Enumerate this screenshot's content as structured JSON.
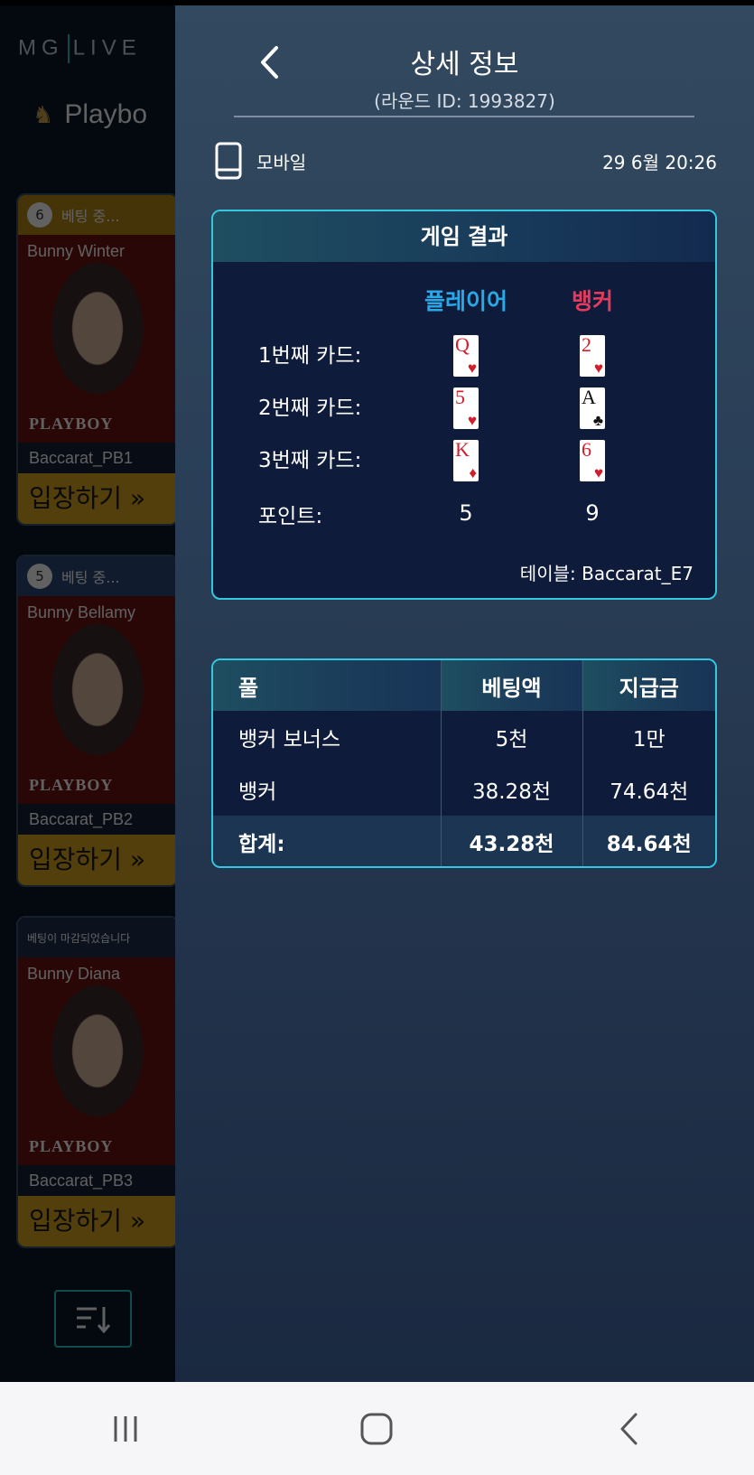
{
  "lobby": {
    "logo_left": "MG",
    "logo_right": "LIVE",
    "brand": "Playbo",
    "cards": [
      {
        "status_num": "6",
        "status": "베팅 중...",
        "dealer": "Bunny Winter",
        "watermark": "PLAYBOY",
        "table": "Baccarat_PB1",
        "enter": "입장하기 »"
      },
      {
        "status_num": "5",
        "status": "베팅 중...",
        "dealer": "Bunny Bellamy",
        "watermark": "PLAYBOY",
        "table": "Baccarat_PB2",
        "enter": "입장하기 »"
      },
      {
        "status_num": "",
        "status": "베팅이 마감되었습니다",
        "dealer": "Bunny Diana",
        "watermark": "PLAYBOY",
        "table": "Baccarat_PB3",
        "enter": "입장하기 »"
      }
    ]
  },
  "panel": {
    "title": "상세 정보",
    "subtitle": "(라운드 ID: 1993827)",
    "device": "모바일",
    "datetime": "29  6월 20:26"
  },
  "result": {
    "header": "게임 결과",
    "player_label": "플레이어",
    "banker_label": "뱅커",
    "rows": [
      {
        "label": "1번째  카드:",
        "player": {
          "rank": "Q",
          "suit": "♥",
          "color": "red"
        },
        "banker": {
          "rank": "2",
          "suit": "♥",
          "color": "red"
        }
      },
      {
        "label": "2번째 카드:",
        "player": {
          "rank": "5",
          "suit": "♥",
          "color": "red"
        },
        "banker": {
          "rank": "A",
          "suit": "♣",
          "color": "black"
        }
      },
      {
        "label": "3번째 카드:",
        "player": {
          "rank": "K",
          "suit": "♦",
          "color": "red"
        },
        "banker": {
          "rank": "6",
          "suit": "♥",
          "color": "red"
        }
      }
    ],
    "points_label": "포인트:",
    "player_points": "5",
    "banker_points": "9",
    "table": "테이블: Baccarat_E7"
  },
  "bets": {
    "headers": [
      "풀",
      "베팅액",
      "지급금"
    ],
    "rows": [
      [
        "뱅커 보너스",
        "5천",
        "1만"
      ],
      [
        "뱅커",
        "38.28천",
        "74.64천"
      ]
    ],
    "total": [
      "합계:",
      "43.28천",
      "84.64천"
    ]
  },
  "colors": {
    "player": "#2aa8e6",
    "banker": "#e43a5e",
    "accent": "#35c6e0"
  }
}
